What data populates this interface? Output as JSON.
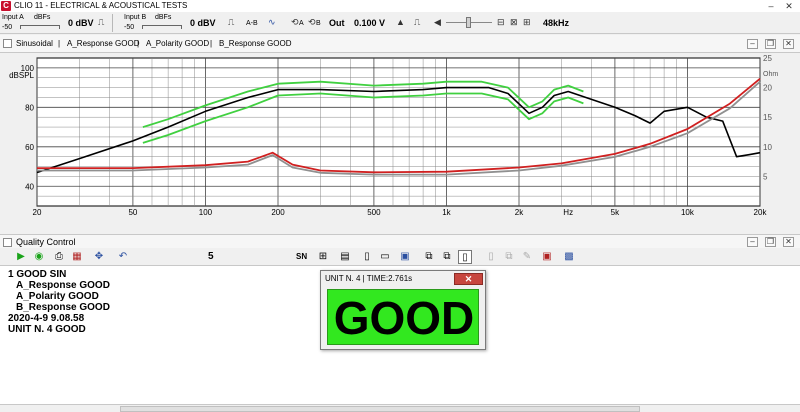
{
  "window": {
    "title": "CLIO 11 - ELECTRICAL & ACOUSTICAL TESTS",
    "logo_letter": "C",
    "min_glyph": "–",
    "close_glyph": "✕"
  },
  "toolbar": {
    "input_a_label": "Input A",
    "input_a_unit": "dBFs",
    "input_a_range": "-50",
    "input_a_value": "0 dBV",
    "input_b_label": "Input B",
    "input_b_unit": "dBFs",
    "input_b_range": "-50",
    "input_b_value": "0 dBV",
    "ab_label": "A-B",
    "ca_label": "A",
    "cb_label": "B",
    "out_label": "Out",
    "out_value": "0.100 V",
    "sample_rate": "48kHz"
  },
  "tabs": [
    "Sinusoidal",
    "A_Response GOOD",
    "A_Polarity GOOD",
    "B_Response GOOD"
  ],
  "chart_data": {
    "type": "line",
    "xscale": "log",
    "xlim": [
      20,
      20000
    ],
    "ylim": [
      30,
      105
    ],
    "y2lim": [
      0,
      25
    ],
    "ylabel": "dBSPL",
    "y2label": "Ohm",
    "xticks": [
      20,
      50,
      100,
      200,
      500,
      1000,
      2000,
      5000,
      10000,
      20000
    ],
    "xtick_labels": [
      "20",
      "50",
      "100",
      "200",
      "500",
      "1k",
      "2k",
      "Hz",
      "5k",
      "10k",
      "20k"
    ],
    "yticks": [
      40,
      60,
      80,
      100
    ],
    "ytick_labels": [
      "40",
      "60",
      "80",
      "100"
    ],
    "y2ticks": [
      5,
      10,
      15,
      20,
      25
    ],
    "y2tick_labels": [
      "5",
      "10",
      "15",
      "20",
      "25"
    ],
    "grid": true,
    "series": [
      {
        "color": "#40d040",
        "axis": "left",
        "x": [
          55,
          70,
          100,
          150,
          200,
          300,
          500,
          800,
          1000,
          1400,
          1800,
          2200,
          2500,
          2800,
          3200,
          3700
        ],
        "y": [
          70,
          74,
          81,
          88,
          92,
          93,
          91,
          92,
          93,
          93,
          90,
          80,
          83,
          89,
          91,
          88
        ]
      },
      {
        "color": "#40d040",
        "axis": "left",
        "x": [
          55,
          70,
          100,
          150,
          200,
          300,
          500,
          800,
          1000,
          1400,
          1800,
          2200,
          2500,
          2800,
          3200,
          3700
        ],
        "y": [
          62,
          66,
          73,
          80,
          86,
          87,
          85,
          86,
          87,
          87,
          84,
          74,
          77,
          83,
          85,
          82
        ]
      },
      {
        "color": "#000000",
        "axis": "left",
        "x": [
          20,
          30,
          50,
          70,
          100,
          150,
          200,
          300,
          500,
          800,
          1000,
          1500,
          1800,
          2200,
          2500,
          2800,
          3200,
          4000,
          5000,
          6000,
          7000,
          8000,
          10000,
          12000,
          14000,
          16000,
          18000,
          20000
        ],
        "y": [
          47,
          54,
          63,
          70,
          78,
          85,
          89,
          89,
          88,
          89,
          90,
          90,
          87,
          77,
          80,
          86,
          88,
          84,
          80,
          76,
          72,
          78,
          80,
          75,
          73,
          55,
          56,
          57
        ]
      },
      {
        "color": "#909090",
        "axis": "right",
        "x": [
          20,
          50,
          100,
          150,
          190,
          230,
          300,
          500,
          1000,
          2000,
          3000,
          5000,
          7000,
          10000,
          15000,
          20000
        ],
        "y": [
          6.0,
          6.0,
          6.5,
          7.0,
          8.6,
          6.5,
          5.6,
          5.3,
          5.3,
          6.0,
          6.8,
          8.3,
          10.0,
          12.3,
          16.5,
          21.0
        ]
      },
      {
        "color": "#d02020",
        "axis": "right",
        "x": [
          20,
          50,
          100,
          150,
          190,
          230,
          300,
          500,
          1000,
          2000,
          3000,
          5000,
          7000,
          10000,
          15000,
          20000
        ],
        "y": [
          6.4,
          6.4,
          6.9,
          7.5,
          9.0,
          7.0,
          6.0,
          5.7,
          5.8,
          6.5,
          7.2,
          8.8,
          10.5,
          13.0,
          17.3,
          21.5
        ]
      }
    ]
  },
  "quality_control": {
    "title": "Quality Control",
    "counter": "5",
    "sn_label": "SN",
    "lines": [
      "1 GOOD SIN",
      "  A_Response GOOD",
      "  A_Polarity GOOD",
      "  B_Response GOOD",
      "2020-4-9 9.08.58",
      "UNIT N. 4 GOOD"
    ]
  },
  "dialog": {
    "title": "UNIT N. 4 | TIME:2.761s",
    "close_glyph": "✕",
    "result": "GOOD"
  }
}
